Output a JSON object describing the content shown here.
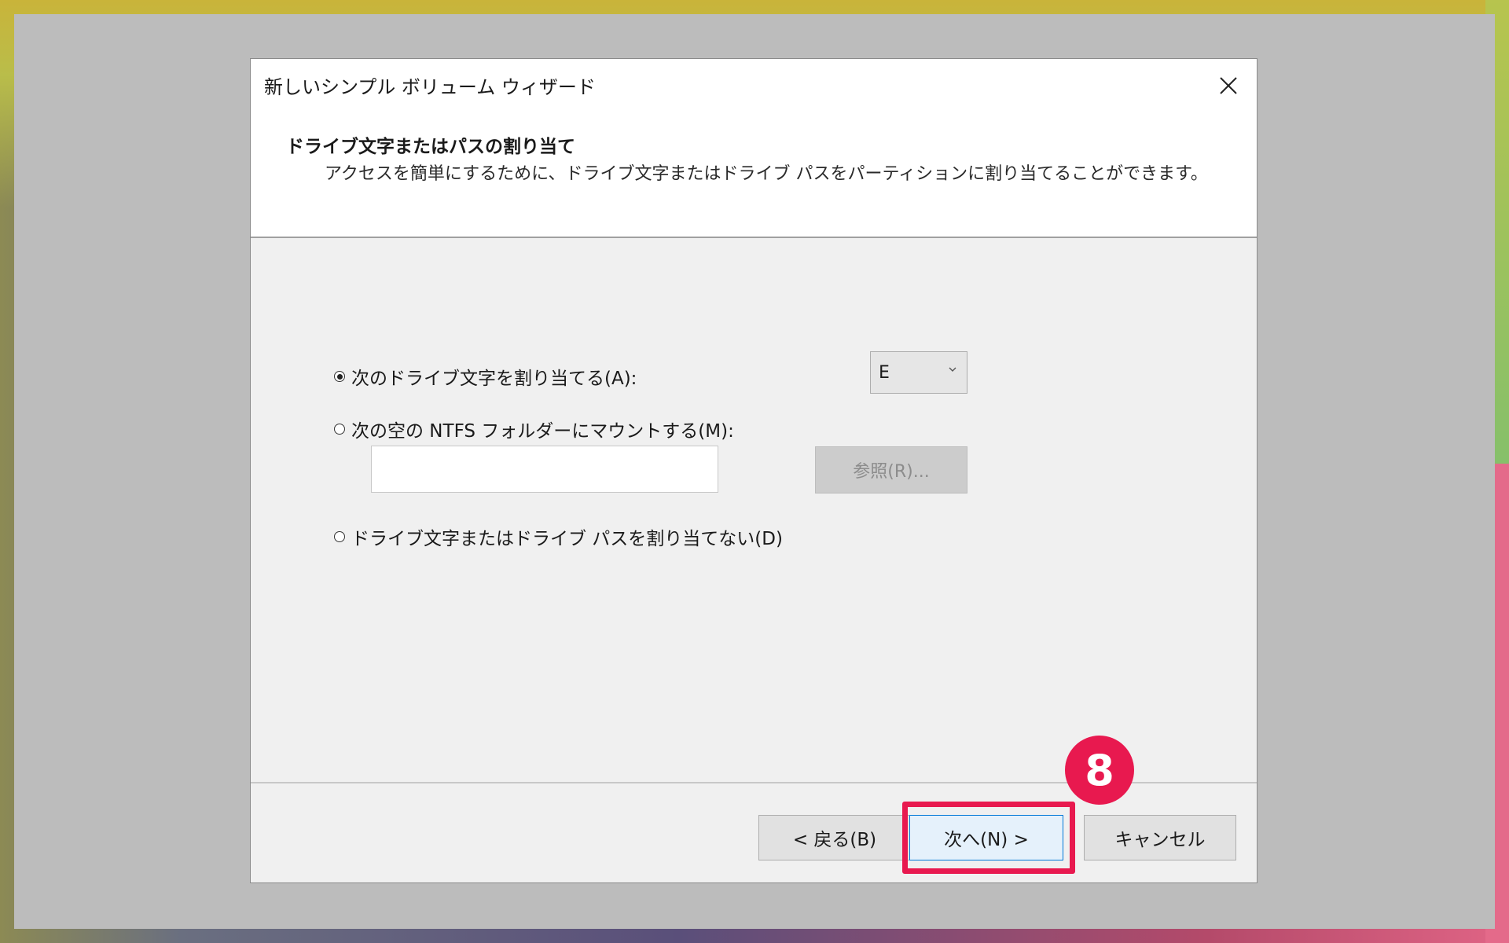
{
  "dialog": {
    "title": "新しいシンプル ボリューム ウィザード",
    "section_title": "ドライブ文字またはパスの割り当て",
    "section_desc": "アクセスを簡単にするために、ドライブ文字またはドライブ パスをパーティションに割り当てることができます。"
  },
  "options": {
    "assign_letter": {
      "label": "次のドライブ文字を割り当てる(A):",
      "selected": true
    },
    "mount_folder": {
      "label": "次の空の NTFS フォルダーにマウントする(M):",
      "selected": false
    },
    "no_assign": {
      "label": "ドライブ文字またはドライブ パスを割り当てない(D)",
      "selected": false
    }
  },
  "drive_letter": {
    "value": "E"
  },
  "path_input": {
    "value": ""
  },
  "browse_button": {
    "label": "参照(R)..."
  },
  "buttons": {
    "back": "< 戻る(B)",
    "next": "次へ(N) >",
    "cancel": "キャンセル"
  },
  "annotation": {
    "step": "8",
    "color": "#e8194f"
  },
  "colors": {
    "accent": "#0078d7",
    "dialog_bg": "#f0f0f0"
  }
}
